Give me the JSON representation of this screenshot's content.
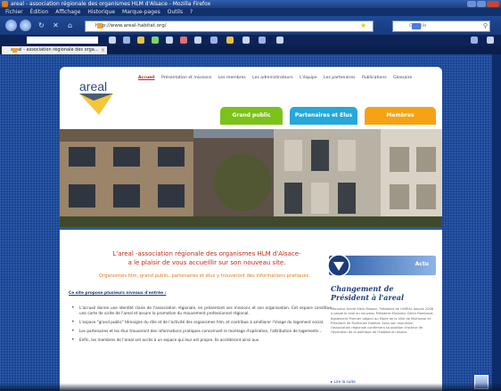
{
  "window": {
    "title": "areal - association régionale des organismes HLM d'Alsace - Mozilla Firefox"
  },
  "menubar": [
    "Fichier",
    "Édition",
    "Affichage",
    "Historique",
    "Marque-pages",
    "Outils",
    "?"
  ],
  "navbar": {
    "url": "http://www.areal-habitat.org/",
    "search_placeholder": "Google"
  },
  "tab": {
    "label": "areal - association régionale des orga..."
  },
  "site": {
    "logo_text": "areal",
    "nav": [
      "Accueil",
      "Présentation et missions",
      "Les membres",
      "Les administrateurs",
      "L'équipe",
      "Les partenaires",
      "Publications",
      "Glossaire"
    ],
    "audience_tabs": [
      {
        "label": "Grand public",
        "color": "#7cc21a"
      },
      {
        "label": "Partenaires et Elus",
        "color": "#26a8d8"
      },
      {
        "label": "Membres",
        "color": "#f5a313"
      }
    ],
    "headline_1": "L'areal -association régionale des organismes HLM d'Alsace-",
    "headline_2": "a le plaisir de vous accueillir sur son nouveau site.",
    "subline": "Organismes hlm, grand public, partenaires et élus y trouveront des informations pratiques.",
    "intro": "Ce site propose plusieurs niveaux d'entrée :",
    "bullets": [
      "L'accueil donne une identité claire de l'association régionale, en présentant ses missions et son organisation. Cet espace constitue une carte de visite de l'areal et assure la promotion du mouvement professionnel régional.",
      "L'espace \"grand public\" témoigne du rôle et de l'activité des organismes hlm, et contribue à améliorer l'image du logement social.",
      "Les partenaires et les élus trouveront des informations pratiques concernant le montage d'opération, l'attribution de logements...",
      "Enfin, les membres de l'areal ont accès à un espace qui leur est propre. Ils accéderont ainsi aux"
    ],
    "news": {
      "badge": "Actu",
      "title": "Changement de Président à l'areal",
      "body": "Monsieur André Klein-Mosser, Président de l'AREAL depuis 2006 a passé le relai au nouveau Président Monsieur Denis Rambaud, également Premier adjoint au Maire de la Ville de Mulhouse et Président de Mulhouse Habitat. Sous son impulsion, l'association régionale confirmera sa position d'acteur de l'évolution de la politique de l'habitat en alsace.",
      "more": "Lire la suite"
    }
  }
}
